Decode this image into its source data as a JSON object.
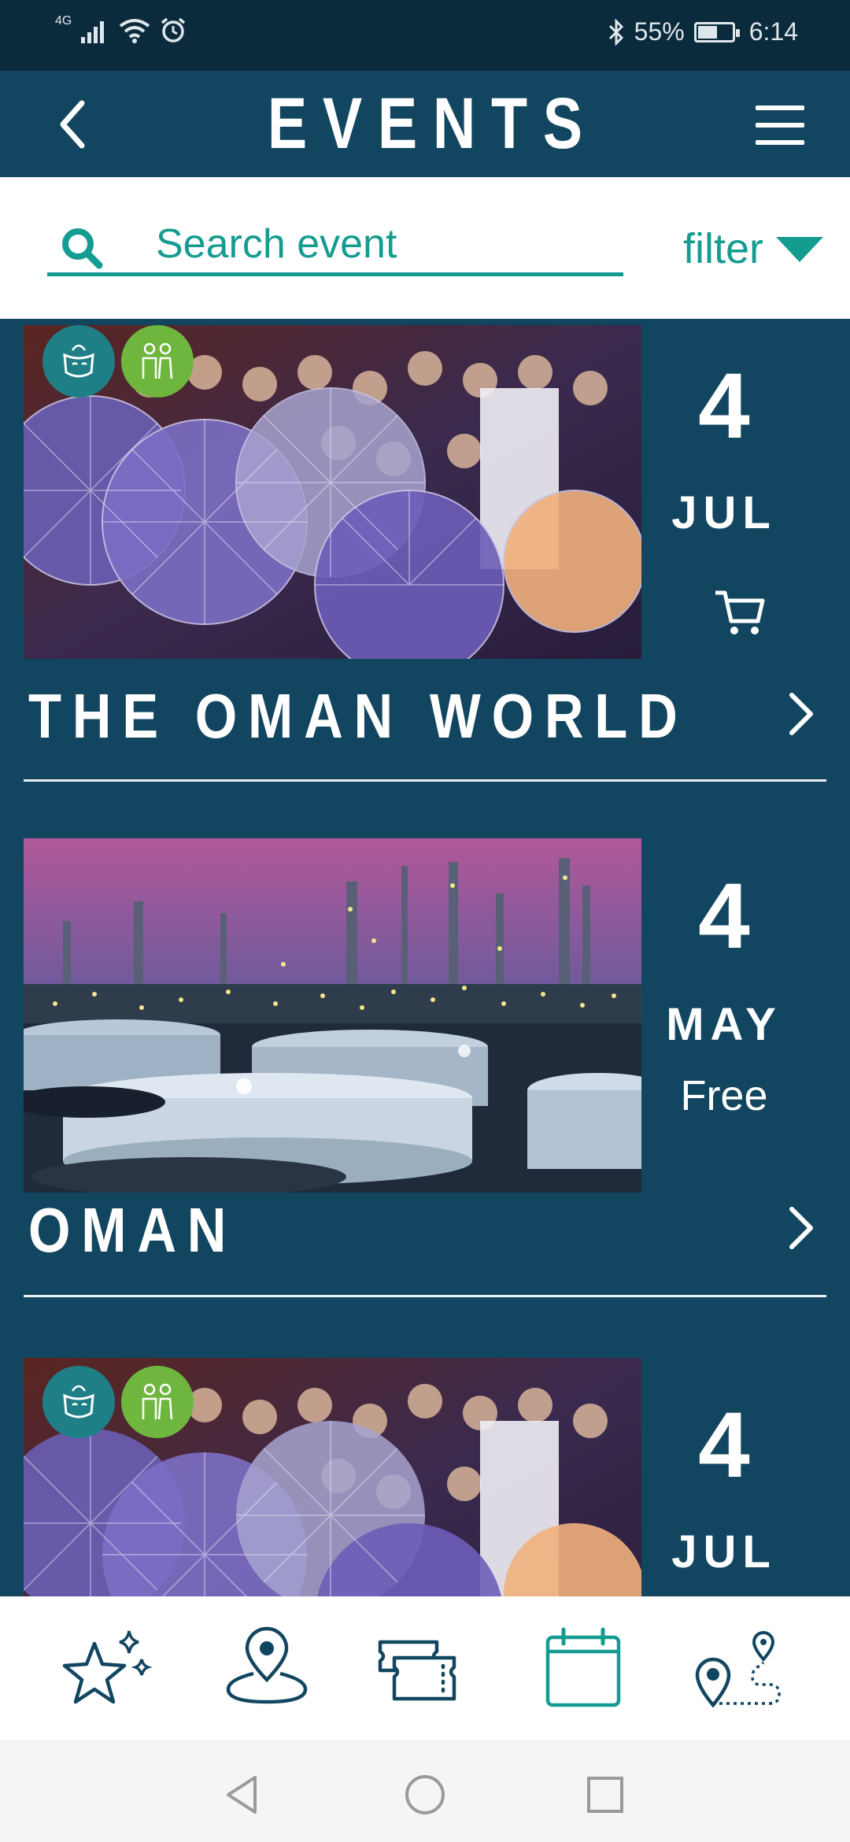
{
  "status_bar": {
    "network": "4G",
    "battery_percent": "55%",
    "battery_level": 0.55,
    "time": "6:14"
  },
  "header": {
    "title": "EVENTS",
    "back_icon": "chevron-left-icon",
    "menu_icon": "hamburger-menu-icon"
  },
  "search": {
    "placeholder": "Search event",
    "value": "",
    "filter_label": "filter"
  },
  "events": [
    {
      "title": "THE OMAN WORLD",
      "day": "4",
      "month": "JUL",
      "price": "",
      "action_icon": "cart-icon",
      "badges": [
        "theatre-masks-icon",
        "people-icon"
      ],
      "image": "opera-umbrellas"
    },
    {
      "title": "OMAN",
      "day": "4",
      "month": "MAY",
      "price": "Free",
      "action_icon": "",
      "badges": [],
      "image": "refinery-night"
    },
    {
      "title": "",
      "day": "4",
      "month": "JUL",
      "price": "",
      "action_icon": "",
      "badges": [
        "theatre-masks-icon",
        "people-icon"
      ],
      "image": "opera-umbrellas"
    }
  ],
  "bottom_nav": [
    {
      "name": "highlights",
      "icon": "sparkle-star-icon",
      "active": false
    },
    {
      "name": "map",
      "icon": "map-pin-icon",
      "active": false
    },
    {
      "name": "tickets",
      "icon": "ticket-icon",
      "active": false
    },
    {
      "name": "calendar",
      "icon": "calendar-icon",
      "active": true
    },
    {
      "name": "routes",
      "icon": "route-icon",
      "active": false
    }
  ],
  "colors": {
    "background": "#124660",
    "status_bar": "#0b2a3c",
    "accent": "#159c91",
    "nav_icon": "#124660",
    "badge_teal": "#1e7f86",
    "badge_green": "#6fb63f"
  }
}
